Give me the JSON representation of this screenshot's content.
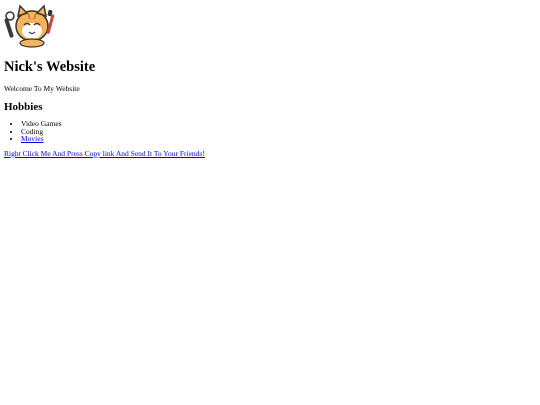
{
  "header": {
    "logo_icon": "cat-artist-mascot-icon",
    "title": "Nick's Website"
  },
  "intro": {
    "welcome": "Welcome To My Website"
  },
  "hobbies": {
    "heading": "Hobbies",
    "items": [
      {
        "label": "Video Games",
        "is_link": false
      },
      {
        "label": "Coding",
        "is_link": false
      },
      {
        "label": "Movies",
        "is_link": true
      }
    ]
  },
  "share": {
    "link_text": "Right Click Me And Press Copy link And Send It To Your Friends!"
  },
  "colors": {
    "link": "#0000ee",
    "text": "#000000",
    "background": "#ffffff"
  }
}
